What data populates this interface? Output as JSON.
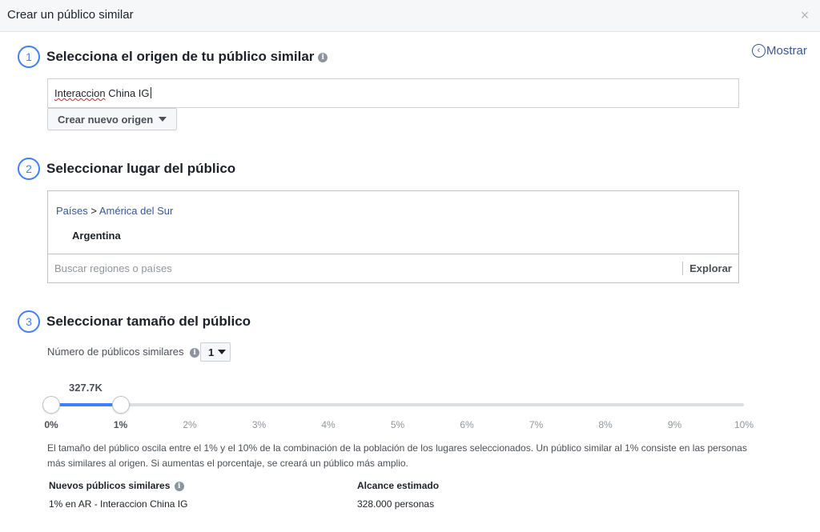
{
  "dialog": {
    "title": "Crear un público similar",
    "close_glyph": "×",
    "show_label": "Mostrar"
  },
  "step1": {
    "number": "1",
    "title": "Selecciona el origen de tu público similar",
    "source_value_misspelled": "Interaccion",
    "source_value_rest": " China IG",
    "create_source_label": "Crear nuevo origen"
  },
  "step2": {
    "number": "2",
    "title": "Seleccionar lugar del público",
    "breadcrumb_root": "Países",
    "breadcrumb_sep": " > ",
    "breadcrumb_region": "América del Sur",
    "country": "Argentina",
    "search_placeholder": "Buscar regiones o países",
    "explore_label": "Explorar"
  },
  "step3": {
    "number": "3",
    "title": "Seleccionar tamaño del público",
    "count_label": "Número de públicos similares",
    "count_value": "1",
    "slider": {
      "value_label": "327.7K",
      "range_start_percent": 0,
      "range_end_percent": 1,
      "ticks": [
        "0%",
        "1%",
        "2%",
        "3%",
        "4%",
        "5%",
        "6%",
        "7%",
        "8%",
        "9%",
        "10%"
      ]
    },
    "description": "El tamaño del público oscila entre el 1% y el 10% de la combinación de la población de los lugares seleccionados. Un público similar al 1% consiste en las personas más similares al origen. Si aumentas el porcentaje, se creará un público más amplio.",
    "summary": {
      "col1_header": "Nuevos públicos similares",
      "col2_header": "Alcance estimado",
      "col1_value": "1% en AR - Interaccion China IG",
      "col2_value": "328.000 personas"
    }
  },
  "colors": {
    "accent": "#4080ff",
    "link": "#365899"
  },
  "icons": [
    "close-icon",
    "chevron-left-circle-icon",
    "info-icon",
    "caret-down-icon"
  ]
}
